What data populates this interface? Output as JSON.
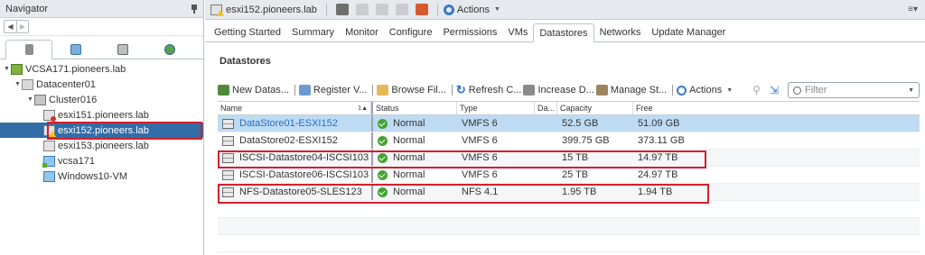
{
  "navigator": {
    "title": "Navigator",
    "tree": [
      {
        "label": "VCSA171.pioneers.lab",
        "icon": "vcenter-icon",
        "depth": 0,
        "expanded": true
      },
      {
        "label": "Datacenter01",
        "icon": "datacenter-icon",
        "depth": 1,
        "expanded": true
      },
      {
        "label": "Cluster016",
        "icon": "cluster-icon",
        "depth": 2,
        "expanded": true
      },
      {
        "label": "esxi151.pioneers.lab",
        "icon": "host-error-icon",
        "depth": 3
      },
      {
        "label": "esxi152.pioneers.lab",
        "icon": "host-warning-icon",
        "depth": 3,
        "selected": true
      },
      {
        "label": "esxi153.pioneers.lab",
        "icon": "host-icon",
        "depth": 3
      },
      {
        "label": "vcsa171",
        "icon": "vm-on-icon",
        "depth": 3
      },
      {
        "label": "Windows10-VM",
        "icon": "vm-icon",
        "depth": 3
      }
    ]
  },
  "object_toolbar": {
    "title": "esxi152.pioneers.lab",
    "actions_label": "Actions"
  },
  "tabs": [
    "Getting Started",
    "Summary",
    "Monitor",
    "Configure",
    "Permissions",
    "VMs",
    "Datastores",
    "Networks",
    "Update Manager"
  ],
  "active_tab": "Datastores",
  "section_title": "Datastores",
  "ds_toolbar": {
    "new": "New Datas...",
    "register": "Register V...",
    "browse": "Browse Fil...",
    "refresh": "Refresh C...",
    "increase": "Increase D...",
    "manage": "Manage St...",
    "actions": "Actions",
    "filter_placeholder": "Filter"
  },
  "table": {
    "columns": [
      "Name",
      "Status",
      "Type",
      "Da...",
      "Capacity",
      "Free"
    ],
    "sort_indicator": "1▲",
    "rows": [
      {
        "name": "DataStore01-ESXI152",
        "status": "Normal",
        "type": "VMFS 6",
        "da": "",
        "capacity": "52.5 GB",
        "free": "51.09 GB"
      },
      {
        "name": "DataStore02-ESXI152",
        "status": "Normal",
        "type": "VMFS 6",
        "da": "",
        "capacity": "399.75 GB",
        "free": "373.11 GB"
      },
      {
        "name": "ISCSI-Datastore04-ISCSI103",
        "status": "Normal",
        "type": "VMFS 6",
        "da": "",
        "capacity": "15 TB",
        "free": "14.97 TB"
      },
      {
        "name": "ISCSI-Datastore06-ISCSI103",
        "status": "Normal",
        "type": "VMFS 6",
        "da": "",
        "capacity": "25 TB",
        "free": "24.97 TB"
      },
      {
        "name": "NFS-Datastore05-SLES123",
        "status": "Normal",
        "type": "NFS 4.1",
        "da": "",
        "capacity": "1.95 TB",
        "free": "1.94 TB"
      }
    ]
  },
  "colors": {
    "selection": "#326da8",
    "row_selected": "#bfdbf4",
    "highlight": "#d0202e",
    "ok": "#46a332"
  }
}
